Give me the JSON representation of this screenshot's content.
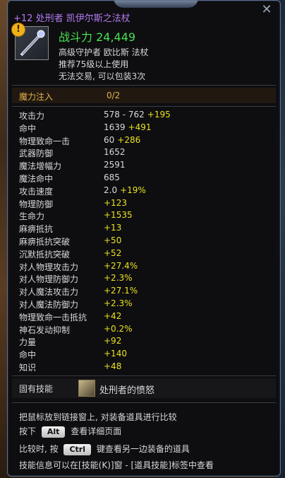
{
  "tooltip": {
    "item_name": "+12 处刑者 凯伊尔斯之法杖",
    "power_label": "战斗力",
    "power_value": "24,449",
    "grade_line": "高级守护者 欧比斯 法杖",
    "level_line": "推荐75级以上使用",
    "trade_line": "无法交易, 可以包装3次",
    "mana_label": "魔力注入",
    "mana_value": "0/2",
    "stats": [
      {
        "name": "攻击力",
        "base": "578 - 762",
        "bonus": "+195"
      },
      {
        "name": "命中",
        "base": "1639",
        "bonus": "+491"
      },
      {
        "name": "物理致命一击",
        "base": "60",
        "bonus": "+286"
      },
      {
        "name": "武器防御",
        "base": "1652",
        "bonus": ""
      },
      {
        "name": "魔法增幅力",
        "base": "2591",
        "bonus": ""
      },
      {
        "name": "魔法命中",
        "base": "685",
        "bonus": ""
      },
      {
        "name": "攻击速度",
        "base": "2.0",
        "bonus": "+19%"
      },
      {
        "name": "物理防御",
        "base": "",
        "bonus": "+123"
      },
      {
        "name": "生命力",
        "base": "",
        "bonus": "+1535"
      },
      {
        "name": "麻痹抵抗",
        "base": "",
        "bonus": "+13"
      },
      {
        "name": "麻痹抵抗突破",
        "base": "",
        "bonus": "+50"
      },
      {
        "name": "沉默抵抗突破",
        "base": "",
        "bonus": "+52"
      },
      {
        "name": "对人物理攻击力",
        "base": "",
        "bonus": "+27.4%"
      },
      {
        "name": "对人物理防御力",
        "base": "",
        "bonus": "+2.3%"
      },
      {
        "name": "对人魔法攻击力",
        "base": "",
        "bonus": "+27.1%"
      },
      {
        "name": "对人魔法防御力",
        "base": "",
        "bonus": "+2.3%"
      },
      {
        "name": "物理致命一击抵抗",
        "base": "",
        "bonus": "+42"
      },
      {
        "name": "神石发动抑制",
        "base": "",
        "bonus": "+0.2%"
      },
      {
        "name": "力量",
        "base": "",
        "bonus": "+92"
      },
      {
        "name": "命中",
        "base": "",
        "bonus": "+140"
      },
      {
        "name": "知识",
        "base": "",
        "bonus": "+48"
      }
    ],
    "skill_label": "固有技能",
    "skill_name": "处刑者的愤怒",
    "hint1": "把鼠标放到链接窗上, 对装备道具进行比较",
    "hint2_pre": "按下",
    "hint2_key": "Alt",
    "hint2_post": "查看详细页面",
    "hint3_pre": "比较时, 按",
    "hint3_key": "Ctrl",
    "hint3_post": "键查看另一边装备的道具",
    "hint4": "技能信息可以在[技能(K)]窗 - [道具技能]标签中查看"
  },
  "colors": {
    "item_name": "#b37cf0",
    "power": "#46e34e",
    "bonus": "#e7e31f",
    "mana": "#e3b04a"
  },
  "icons": [
    "close-icon",
    "warning-icon",
    "staff-icon",
    "skill-icon"
  ]
}
